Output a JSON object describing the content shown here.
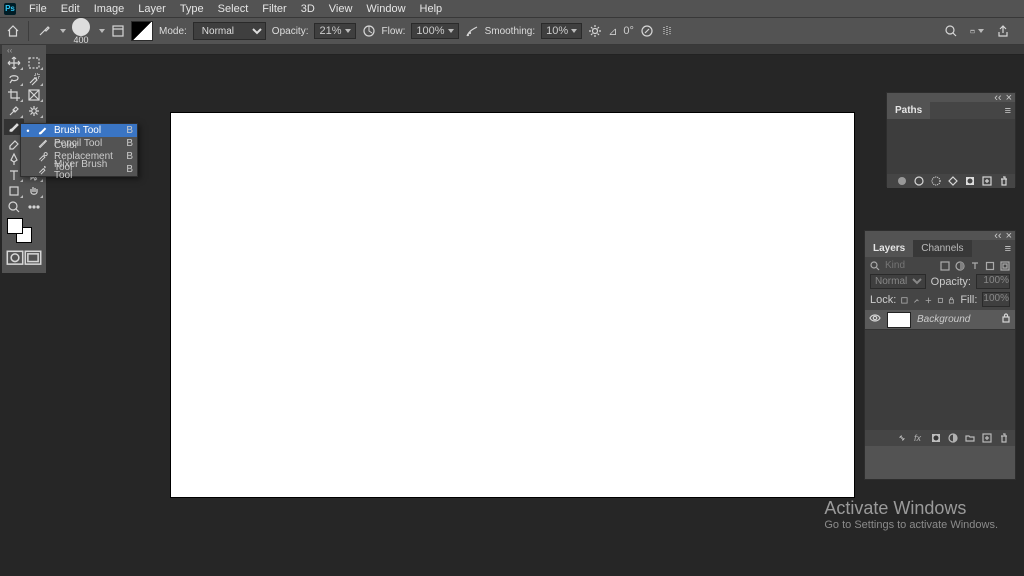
{
  "menubar": {
    "items": [
      "File",
      "Edit",
      "Image",
      "Layer",
      "Type",
      "Select",
      "Filter",
      "3D",
      "View",
      "Window",
      "Help"
    ]
  },
  "optbar": {
    "brush_size": "400",
    "mode_label": "Mode:",
    "mode_value": "Normal",
    "opacity_label": "Opacity:",
    "opacity_value": "21%",
    "flow_label": "Flow:",
    "flow_value": "100%",
    "smoothing_label": "Smoothing:",
    "smoothing_value": "10%",
    "angle_symbol": "⊿",
    "angle_value": "0°"
  },
  "brush_flyout": {
    "items": [
      {
        "label": "Brush Tool",
        "key": "B",
        "selected": true
      },
      {
        "label": "Pencil Tool",
        "key": "B",
        "selected": false
      },
      {
        "label": "Color Replacement Tool",
        "key": "B",
        "selected": false
      },
      {
        "label": "Mixer Brush Tool",
        "key": "B",
        "selected": false
      }
    ]
  },
  "paths_panel": {
    "title": "Paths"
  },
  "layers_panel": {
    "tabs": [
      "Layers",
      "Channels"
    ],
    "active_tab": 0,
    "kind_placeholder": "Kind",
    "blend_mode": "Normal",
    "opacity_label": "Opacity:",
    "opacity_value": "100%",
    "lock_label": "Lock:",
    "fill_label": "Fill:",
    "fill_value": "100%",
    "layers": [
      {
        "name": "Background",
        "visible": true,
        "locked": true
      }
    ]
  },
  "watermark": {
    "line1": "Activate Windows",
    "line2": "Go to Settings to activate Windows."
  },
  "colors": {
    "canvas": "#ffffff",
    "workspace": "#262626",
    "panel": "#535353",
    "highlight": "#3a75c4"
  }
}
